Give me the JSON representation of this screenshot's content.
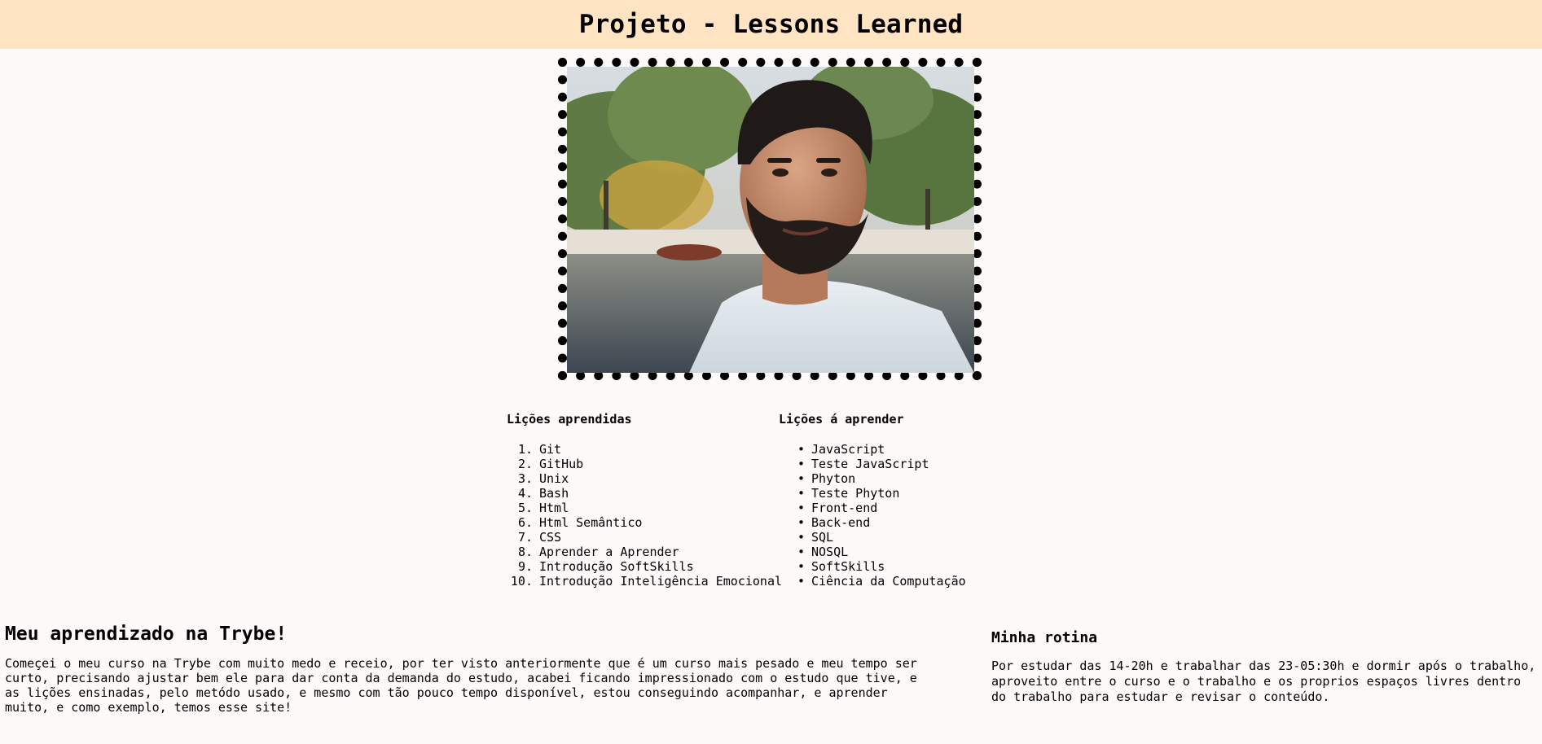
{
  "header": {
    "title": "Projeto - Lessons Learned"
  },
  "lessons_learned": {
    "title": "Lições aprendidas",
    "items": [
      {
        "num": "1.",
        "label": "Git"
      },
      {
        "num": "2.",
        "label": "GitHub"
      },
      {
        "num": "3.",
        "label": "Unix"
      },
      {
        "num": "4.",
        "label": "Bash"
      },
      {
        "num": "5.",
        "label": "Html"
      },
      {
        "num": "6.",
        "label": "Html Semântico"
      },
      {
        "num": "7.",
        "label": "CSS"
      },
      {
        "num": "8.",
        "label": "Aprender a Aprender"
      },
      {
        "num": "9.",
        "label": "Introdução SoftSkills"
      },
      {
        "num": "10.",
        "label": "Introdução Inteligência Emocional"
      }
    ]
  },
  "lessons_to_learn": {
    "title": "Lições á aprender",
    "bullet": "•",
    "items": [
      {
        "label": "JavaScript"
      },
      {
        "label": "Teste JavaScript"
      },
      {
        "label": "Phyton"
      },
      {
        "label": "Teste Phyton"
      },
      {
        "label": "Front-end"
      },
      {
        "label": "Back-end"
      },
      {
        "label": "SQL"
      },
      {
        "label": "NOSQL"
      },
      {
        "label": "SoftSkills"
      },
      {
        "label": "Ciência da Computação"
      }
    ]
  },
  "about": {
    "title": "Meu aprendizado na Trybe!",
    "text": "Começei o meu curso na Trybe com muito medo e receio, por ter visto anteriormente que é um curso mais pesado e meu tempo ser curto, precisando ajustar bem ele para dar conta da demanda do estudo, acabei ficando impressionado com o estudo que tive, e as lições ensinadas, pelo metódo usado, e mesmo com tão pouco tempo disponível, estou conseguindo acompanhar, e aprender muito, e como exemplo, temos esse site!"
  },
  "routine": {
    "title": "Minha rotina",
    "text": "Por estudar das 14-20h e trabalhar das 23-05:30h e dormir após o trabalho, aproveito entre o curso e o trabalho e os proprios espaços livres dentro do trabalho para estudar e revisar o conteúdo."
  },
  "colors": {
    "header_bg": "#ffe4c4",
    "page_bg": "#fefafa",
    "frame_border": "#000000"
  }
}
